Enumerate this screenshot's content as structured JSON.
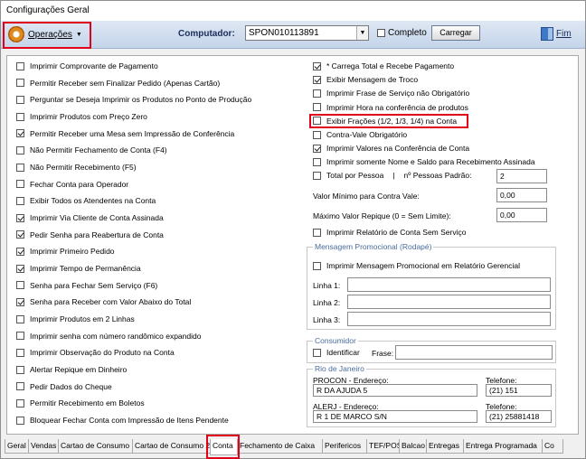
{
  "window": {
    "title": "Configurações Geral"
  },
  "toolbar": {
    "operacoes_label": "Operações",
    "computador_label": "Computador:",
    "computador_value": "SPON010113891",
    "completo_label": "Completo",
    "completo_checked": false,
    "carregar_label": "Carregar",
    "fim_label": "Fim"
  },
  "left_options": [
    {
      "label": "Imprimir Comprovante de Pagamento",
      "checked": false
    },
    {
      "label": "Permitir Receber sem Finalizar Pedido (Apenas Cartão)",
      "checked": false
    },
    {
      "label": "Perguntar se Deseja Imprimir os Produtos no Ponto de Produção",
      "checked": false
    },
    {
      "label": "Imprimir Produtos com Preço Zero",
      "checked": false
    },
    {
      "label": "Permitir Receber uma Mesa sem Impressão de Conferência",
      "checked": true
    },
    {
      "label": "Não Permitir Fechamento de Conta (F4)",
      "checked": false
    },
    {
      "label": "Não Permitir Recebimento (F5)",
      "checked": false
    },
    {
      "label": "Fechar Conta para Operador",
      "checked": false
    },
    {
      "label": "Exibir Todos os Atendentes na Conta",
      "checked": false
    },
    {
      "label": "Imprimir Via Cliente de Conta Assinada",
      "checked": true
    },
    {
      "label": "Pedir Senha para Reabertura de Conta",
      "checked": true
    },
    {
      "label": "Imprimir Primeiro Pedido",
      "checked": true
    },
    {
      "label": "Imprimir Tempo de Permanência",
      "checked": true
    },
    {
      "label": "Senha para Fechar Sem Serviço (F6)",
      "checked": false
    },
    {
      "label": "Senha para Receber com Valor Abaixo do Total",
      "checked": true
    },
    {
      "label": "Imprimir Produtos em 2 Linhas",
      "checked": false
    },
    {
      "label": "Imprimir senha com número randômico expandido",
      "checked": false
    },
    {
      "label": "Imprimir Observação do Produto na Conta",
      "checked": false
    },
    {
      "label": "Alertar Repique em Dinheiro",
      "checked": false
    },
    {
      "label": "Pedir Dados do Cheque",
      "checked": false
    },
    {
      "label": "Permitir Recebimento em Boletos",
      "checked": false
    },
    {
      "label": "Bloquear Fechar Conta com Impressão de Itens Pendente",
      "checked": false
    }
  ],
  "right_options": [
    {
      "label": "* Carrega Total e Recebe Pagamento",
      "checked": true
    },
    {
      "label": "Exibir Mensagem de Troco",
      "checked": true
    },
    {
      "label": "Imprimir Frase de Serviço não Obrigatório",
      "checked": false
    },
    {
      "label": "Imprimir Hora na conferência de produtos",
      "checked": false
    },
    {
      "label": "Exibir Frações (1/2, 1/3, 1/4) na Conta",
      "checked": false
    },
    {
      "label": "Contra-Vale Obrigatório",
      "checked": false
    },
    {
      "label": "Imprimir Valores na Conferência de Conta",
      "checked": true
    },
    {
      "label": "Imprimir somente Nome e Saldo para Recebimento Assinada",
      "checked": false
    }
  ],
  "total_pessoa": {
    "label": "Total por Pessoa",
    "separator": "|",
    "pessoas_label": "nº Pessoas Padrão:",
    "pessoas_value": "2",
    "checked": false
  },
  "valor_minimo": {
    "label": "Valor Mínimo para Contra Vale:",
    "value": "0,00"
  },
  "valor_repique": {
    "label": "Máximo Valor Repique (0 = Sem Limite):",
    "value": "0,00"
  },
  "relatorio_sem_servico": {
    "label": "Imprimir Relatório de Conta Sem Serviço",
    "checked": false
  },
  "mensagem_promocional": {
    "title": "Mensagem Promocional (Rodapé)",
    "imprimir_label": "Imprimir Mensagem Promocional em Relatório Gerencial",
    "imprimir_checked": false,
    "linha1_label": "Linha 1:",
    "linha1_value": "",
    "linha2_label": "Linha 2:",
    "linha2_value": "",
    "linha3_label": "Linha 3:",
    "linha3_value": ""
  },
  "consumidor": {
    "title": "Consumidor",
    "identificar_label": "Identificar",
    "identificar_checked": false,
    "frase_label": "Frase:",
    "frase_value": ""
  },
  "rio": {
    "title": "Rio de Janeiro",
    "procon_label": "PROCON - Endereço:",
    "procon_value": "R DA AJUDA 5",
    "procon_tel_label": "Telefone:",
    "procon_tel_value": "(21) 151",
    "alerj_label": "ALERJ - Endereço:",
    "alerj_value": "R 1 DE MARCO S/N",
    "alerj_tel_label": "Telefone:",
    "alerj_tel_value": "(21) 25881418"
  },
  "tabs": [
    "Geral",
    "Vendas",
    "Cartao de Consumo",
    "Cartao de Consumo 2",
    "Conta",
    "Fechamento de Caixa",
    "Perifericos",
    "TEF/POS",
    "Balcao",
    "Entregas",
    "Entrega Programada",
    "Co"
  ],
  "active_tab": "Conta"
}
